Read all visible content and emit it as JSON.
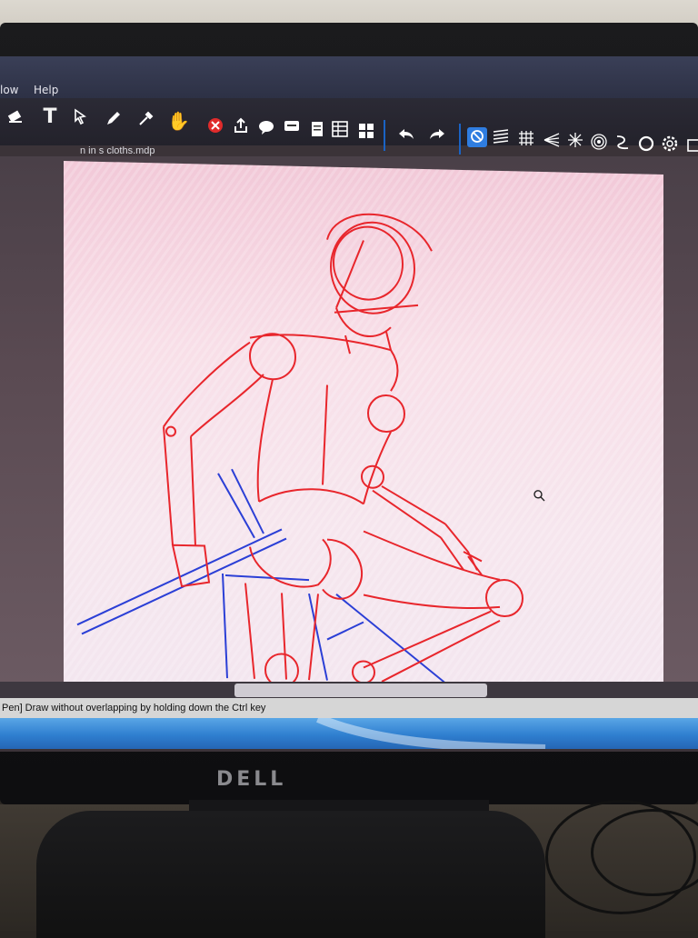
{
  "menu": {
    "items": [
      {
        "label": "low"
      },
      {
        "label": "Help"
      }
    ]
  },
  "toolbar": {
    "icons": [
      "eraser-icon",
      "text-icon",
      "select-icon",
      "pen-icon",
      "dropper-icon",
      "hand-icon",
      "delete-icon",
      "share-icon",
      "speech-bubble-icon",
      "comment-icon",
      "page-icon",
      "table-icon",
      "grid-icon",
      "undo-icon",
      "redo-icon",
      "snap-off-icon",
      "parallel-snap-icon",
      "grid-snap-icon",
      "perspective-icon",
      "radial-icon",
      "concentric-icon",
      "curve-icon",
      "circle-icon",
      "settings-icon",
      "edit-icon"
    ]
  },
  "document": {
    "tab_title": "n in s cloths.mdp"
  },
  "status": {
    "message": "Pen] Draw without overlapping by holding down the Ctrl key"
  },
  "monitor": {
    "brand": "DELL"
  },
  "colors": {
    "sketch_red": "#e8262c",
    "sketch_blue": "#2b3fd6",
    "accent": "#1a63c4"
  }
}
